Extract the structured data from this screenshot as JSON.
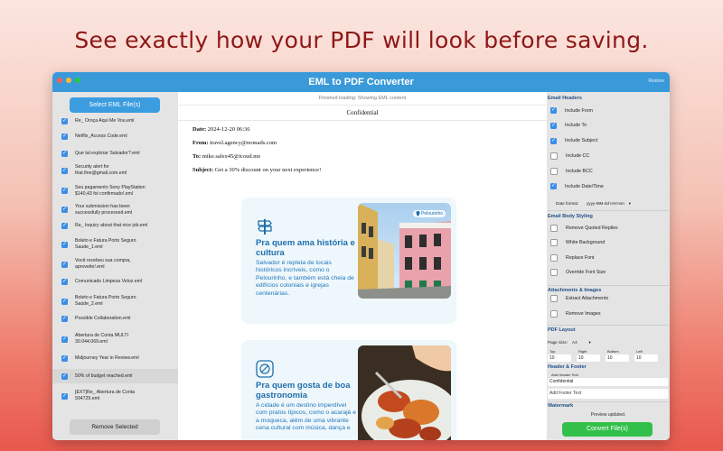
{
  "headline": "See exactly how your PDF will look before saving.",
  "window": {
    "title": "EML to PDF Converter",
    "restore_label": "Restore"
  },
  "left": {
    "select_button": "Select EML File(s)",
    "remove_button": "Remove Selected",
    "files": [
      {
        "name": "Re_ Oroça Aqui Me Vou.eml",
        "checked": true,
        "selected": false
      },
      {
        "name": "Netflix_Access Code.eml",
        "checked": true,
        "selected": false
      },
      {
        "name": "Que tal explorar Salvador?.eml",
        "checked": true,
        "selected": false
      },
      {
        "name": "Security alert for\nthat.fine@gmail.com.eml",
        "checked": true,
        "selected": false
      },
      {
        "name": "Seu pagamento Sony PlayStation\n$140,43 foi confirmado!.eml",
        "checked": true,
        "selected": false
      },
      {
        "name": "Your submission has been\nsuccessfully processed.eml",
        "checked": true,
        "selected": false
      },
      {
        "name": "Re_ Inquiry about that nice job.eml",
        "checked": true,
        "selected": false
      },
      {
        "name": "Boleto e Fatura Porto Seguro\nSaude_1.eml",
        "checked": true,
        "selected": false
      },
      {
        "name": "Você recebeu sua compra,\naproveite!.eml",
        "checked": true,
        "selected": false
      },
      {
        "name": "Comunicado Limpeza Veloz.eml",
        "checked": true,
        "selected": false
      },
      {
        "name": "Boleto e Fatura Porto Seguro\nSaúde_2.eml",
        "checked": true,
        "selected": false
      },
      {
        "name": "Possible Collaboration.eml",
        "checked": true,
        "selected": false
      },
      {
        "name": "Abertura de Conta MULTI\n30.044.069.eml",
        "checked": true,
        "selected": false
      },
      {
        "name": "Midjourney Year in Review.eml",
        "checked": true,
        "selected": false
      },
      {
        "name": "50% of budget reached.eml",
        "checked": true,
        "selected": true
      },
      {
        "name": "[EXT]Re_ Abertura de Conta\n934729.eml",
        "checked": true,
        "selected": false
      }
    ]
  },
  "center": {
    "status": "Finished loading: Showing EML content",
    "confidential": "Confidential",
    "headers": {
      "date_label": "Date:",
      "date_value": "2024-12-20 06:36",
      "from_label": "From:",
      "from_value": "travel.agency@nomads.com",
      "to_label": "To:",
      "to_value": "mike.salex45@icoud.me",
      "subject_label": "Subject:",
      "subject_value": "Get a 30% discount on your next experience!"
    },
    "card1": {
      "title": "Pra quem ama história e cultura",
      "body": "Salvador é repleta de locais históricos incríveis, como o Pelourinho, e também está cheia de edifícios coloniais e igrejas centenárias.",
      "photo_tag": "Pelourinho"
    },
    "card2": {
      "title": "Pra quem gosta de boa gastronomia",
      "body": "A cidade é um destino imperdível com pratos típicos, como o acarajé e a moqueca, além de uma vibrante cena cultural com música, dança e"
    }
  },
  "right": {
    "email_headers_title": "Email Headers",
    "header_options": [
      {
        "label": "Include From",
        "checked": true
      },
      {
        "label": "Include To",
        "checked": true
      },
      {
        "label": "Include Subject",
        "checked": true
      },
      {
        "label": "Include CC",
        "checked": false
      },
      {
        "label": "Include BCC",
        "checked": false
      },
      {
        "label": "Include Date/Time",
        "checked": true
      }
    ],
    "date_format_label": "Date format:",
    "date_format_value": "yyyy-MM-dd HH:mm",
    "body_styling_title": "Email Body Styling",
    "body_options": [
      {
        "label": "Remove Quoted Replies",
        "checked": false
      },
      {
        "label": "White Background",
        "checked": false
      },
      {
        "label": "Replace Font",
        "checked": false
      },
      {
        "label": "Override Font Size",
        "checked": false
      }
    ],
    "attachments_title": "Attachments & Images",
    "attachment_options": [
      {
        "label": "Extract Attachments",
        "checked": false
      },
      {
        "label": "Remove Images",
        "checked": false
      }
    ],
    "pdf_layout_title": "PDF Layout",
    "page_size_label": "Page Size:",
    "page_size_value": "A4",
    "margins": {
      "top_label": "Top",
      "top_value": "10",
      "right_label": "Right",
      "right_value": "10",
      "bottom_label": "Bottom",
      "bottom_value": "10",
      "left_label": "Left",
      "left_value": "10"
    },
    "header_footer_title": "Header & Footer",
    "header_text_label": "Add Header Text",
    "header_text_value": "Confidential",
    "footer_text_placeholder": "Add Footer Text",
    "watermark_title": "Watermark",
    "preview_status": "Preview updated.",
    "convert_button": "Convert File(s)"
  },
  "colors": {
    "titlebar": "#3a9ad9",
    "accent_blue": "#3b9de0",
    "convert_green": "#33c04a",
    "headline_red": "#8f1717",
    "card_text_blue": "#1f6fad"
  }
}
